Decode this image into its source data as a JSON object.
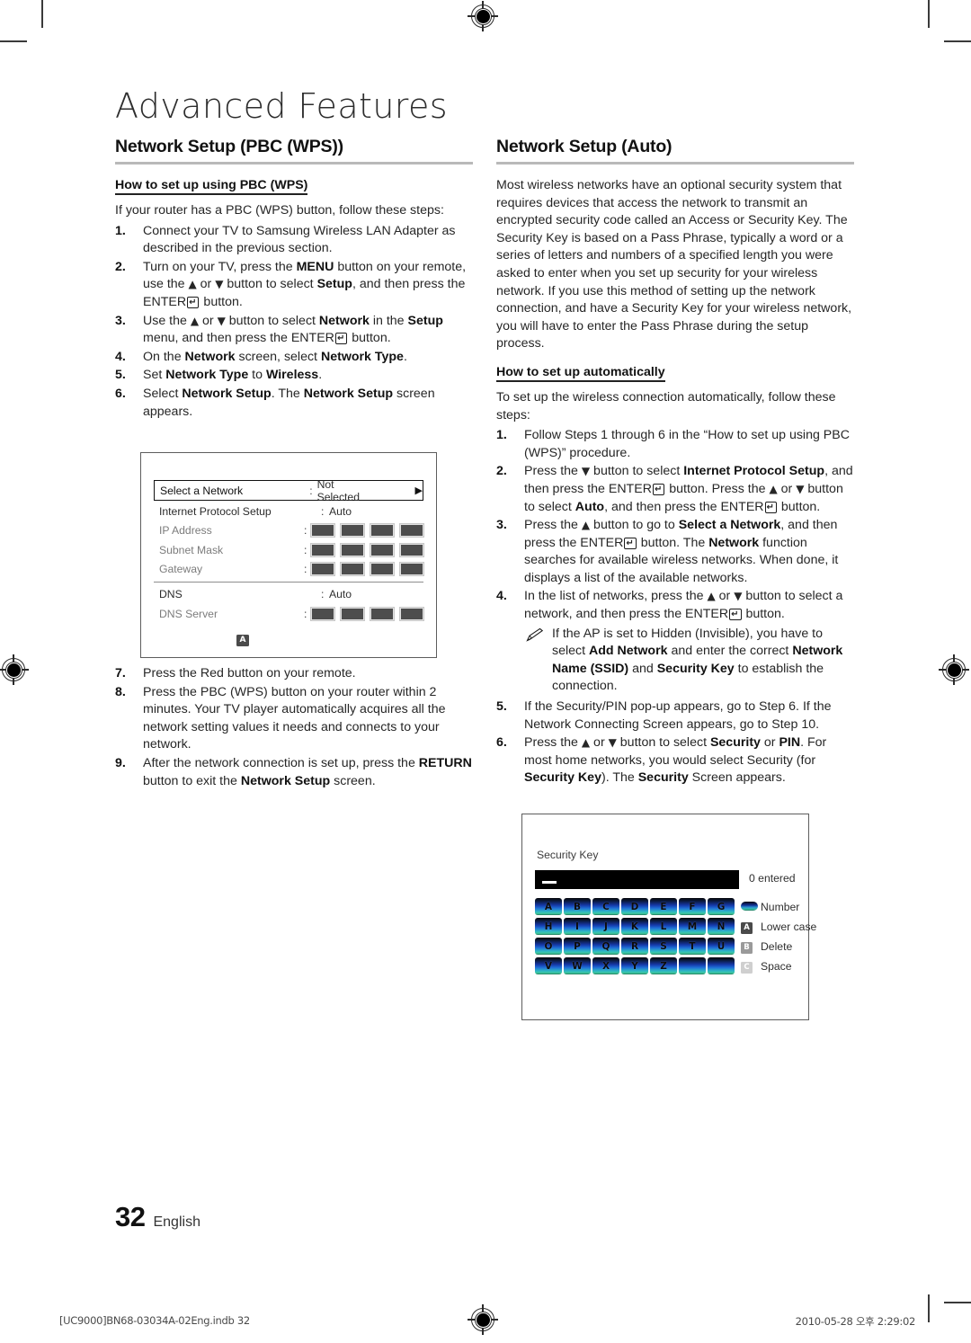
{
  "chapter_title": "Advanced Features",
  "left_column": {
    "section_title": "Network Setup (PBC (WPS))",
    "subheading": "How to set up using PBC (WPS)",
    "intro": "If your router has a PBC (WPS) button, follow these steps:",
    "steps": [
      {
        "num": "1.",
        "text": "Connect your TV to Samsung Wireless LAN Adapter as described in the previous section."
      },
      {
        "num": "2.",
        "text": "Turn on your TV, press the MENU button on your remote, use the ▲ or ▼ button to select Setup, and then press the ENTER button."
      },
      {
        "num": "3.",
        "text": "Use the ▲ or ▼ button to select Network in the Setup menu, and then press the ENTER button."
      },
      {
        "num": "4.",
        "text": "On the Network screen, select Network Type."
      },
      {
        "num": "5.",
        "text": "Set Network Type to Wireless."
      },
      {
        "num": "6.",
        "text": "Select Network Setup. The Network Setup screen appears."
      },
      {
        "num": "7.",
        "text": "Press the Red button on your remote."
      },
      {
        "num": "8.",
        "text": "Press the PBC (WPS) button on your router within 2 minutes. Your TV player automatically acquires all the network setting values it needs and connects to your network."
      },
      {
        "num": "9.",
        "text": "After the network connection is set up, press the RETURN button to exit the Network Setup screen."
      }
    ]
  },
  "network_figure": {
    "rows": [
      {
        "label": "Select a Network",
        "value": "Not Selected",
        "caret": "▶",
        "type": "selected"
      },
      {
        "label": "Internet Protocol Setup",
        "value": "Auto",
        "type": "value"
      },
      {
        "label": "IP Address",
        "type": "boxes"
      },
      {
        "label": "Subnet Mask",
        "type": "boxes"
      },
      {
        "label": "Gateway",
        "type": "boxes"
      },
      {
        "label": "DNS",
        "value": "Auto",
        "type": "value"
      },
      {
        "label": "DNS Server",
        "type": "boxes"
      }
    ],
    "colon": ":",
    "red_key": "A"
  },
  "right_column": {
    "section_title": "Network Setup (Auto)",
    "intro": "Most wireless networks have an optional security system that requires devices that access the network to transmit an encrypted security code called an Access or Security Key. The Security Key is based on a Pass Phrase, typically a word or a series of letters and numbers of a specified length you were asked to enter when you set up security for your wireless network.  If you use this method of setting up the network connection, and have a Security Key for your wireless network, you will have to enter the Pass Phrase during the setup process.",
    "subheading": "How to set up automatically",
    "intro2": "To set up the wireless connection automatically, follow these steps:",
    "steps": [
      {
        "num": "1.",
        "text": "Follow Steps 1 through 6 in the “How to set up using PBC (WPS)” procedure."
      },
      {
        "num": "2.",
        "text": "Press the ▼ button to select Internet Protocol Setup, and then press the ENTER button. Press the ▲ or ▼ button to select Auto, and then press the ENTER button."
      },
      {
        "num": "3.",
        "text": "Press the ▲ button to go to Select a Network, and then press the ENTER button. The Network function searches for available wireless networks. When done, it displays a list of the available networks."
      },
      {
        "num": "4.",
        "text": "In the list of networks, press the ▲ or ▼ button to select a network, and then press the ENTER button."
      },
      {
        "num": "5.",
        "text": "If the Security/PIN pop-up appears, go to Step 6. If the Network Connecting Screen appears, go to Step 10."
      },
      {
        "num": "6.",
        "text": "Press the ▲ or ▼ button to select Security or PIN. For most home networks, you would select Security (for Security Key). The Security Screen appears."
      }
    ],
    "note": "If the AP is set to Hidden (Invisible), you have to select Add Network and enter the correct Network Name (SSID) and Security Key to establish the connection."
  },
  "security_figure": {
    "title": "Security Key",
    "entered": "0 entered",
    "keys": [
      "A",
      "B",
      "C",
      "D",
      "E",
      "F",
      "G",
      "H",
      "I",
      "J",
      "K",
      "L",
      "M",
      "N",
      "O",
      "P",
      "Q",
      "R",
      "S",
      "T",
      "U",
      "V",
      "W",
      "X",
      "Y",
      "Z",
      "",
      ""
    ],
    "legend": [
      {
        "glyph": "number-pill",
        "label": "Number"
      },
      {
        "glyph": "A",
        "label": "Lower case"
      },
      {
        "glyph": "B",
        "label": "Delete"
      },
      {
        "glyph": "C",
        "label": "Space"
      }
    ]
  },
  "footer": {
    "page_number": "32",
    "language": "English",
    "print_left": "[UC9000]BN68-03034A-02Eng.indb   32",
    "print_right": "2010-05-28   오후 2:29:02"
  }
}
